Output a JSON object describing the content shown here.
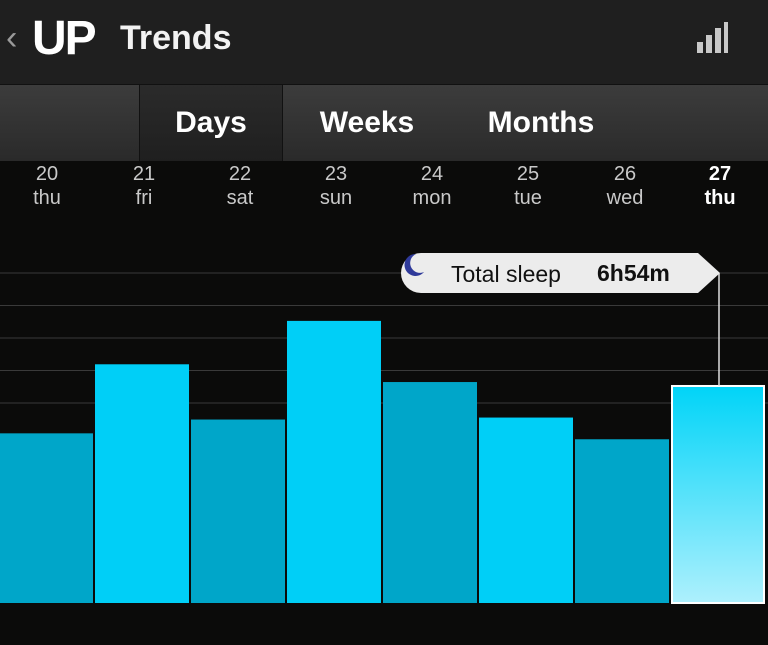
{
  "header": {
    "back_label": "‹",
    "logo": "UP",
    "title": "Trends",
    "stats_icon": "bar-chart-icon"
  },
  "tabs": [
    {
      "label": "Days",
      "active": true
    },
    {
      "label": "Weeks",
      "active": false
    },
    {
      "label": "Months",
      "active": false
    }
  ],
  "days": [
    {
      "num": "20",
      "dow": "thu"
    },
    {
      "num": "21",
      "dow": "fri"
    },
    {
      "num": "22",
      "dow": "sat"
    },
    {
      "num": "23",
      "dow": "sun"
    },
    {
      "num": "24",
      "dow": "mon"
    },
    {
      "num": "25",
      "dow": "tue"
    },
    {
      "num": "26",
      "dow": "wed"
    },
    {
      "num": "27",
      "dow": "thu"
    }
  ],
  "tooltip": {
    "icon": "moon-icon",
    "label": "Total sleep",
    "value": "6h54m"
  },
  "colors": {
    "bar_dark": "#00a6c9",
    "bar_bright": "#00cff7",
    "bar_selected_top": "#00d4f8",
    "bar_selected_bottom": "#aef0fd",
    "gridline": "#3a3a3a",
    "background": "#0b0b0a"
  },
  "chart_data": {
    "type": "bar",
    "categories": [
      "20 thu",
      "21 fri",
      "22 sat",
      "23 sun",
      "24 mon",
      "25 tue",
      "26 wed",
      "27 thu"
    ],
    "values": [
      4.3,
      6.05,
      4.65,
      7.15,
      5.6,
      4.7,
      4.15,
      5.5
    ],
    "highlight_index": 7,
    "title": "",
    "ylabel": "",
    "ylim": [
      0,
      9.2
    ],
    "grid": true
  }
}
